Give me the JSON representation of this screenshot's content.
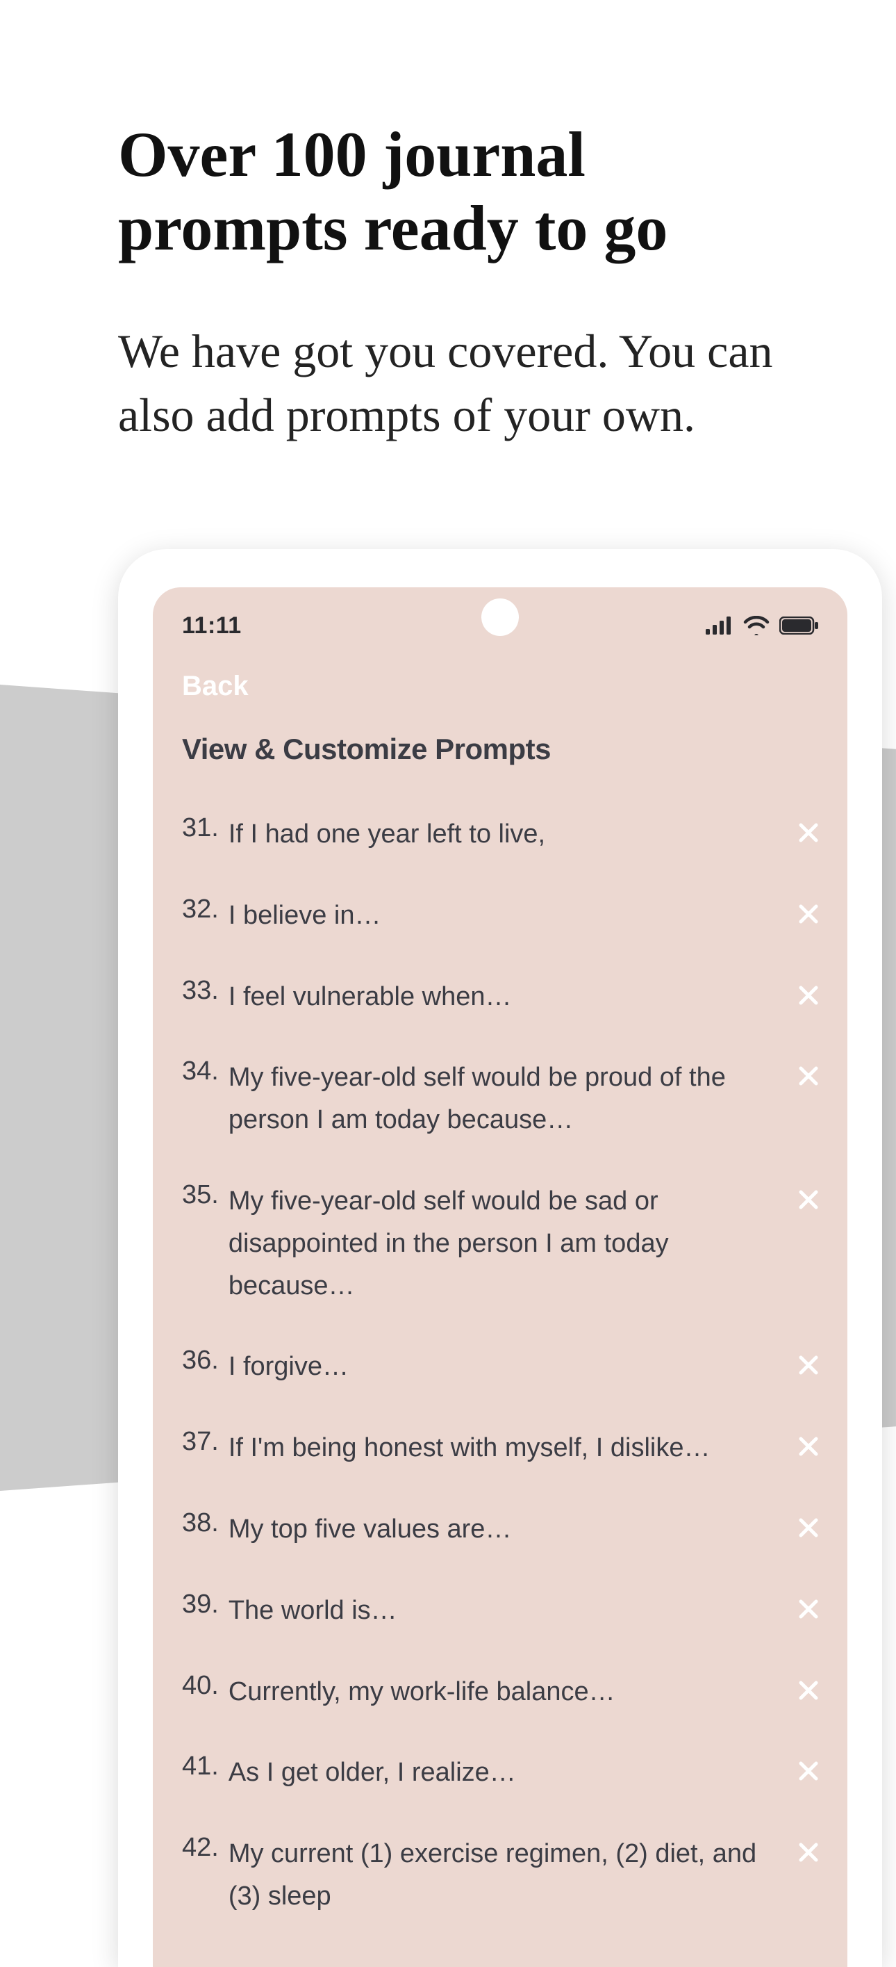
{
  "marketing": {
    "headline": "Over 100 journal prompts ready to go",
    "subhead": "We have got you covered. You can also add prompts of your own."
  },
  "statusBar": {
    "time": "11:11"
  },
  "nav": {
    "back": "Back"
  },
  "section": {
    "title": "View & Customize Prompts"
  },
  "prompts": [
    {
      "n": "31.",
      "text": "If I had one year left to live,"
    },
    {
      "n": "32.",
      "text": "I believe in…"
    },
    {
      "n": "33.",
      "text": "I feel vulnerable when…"
    },
    {
      "n": "34.",
      "text": "My five-year-old self would be proud of the person I am today because…"
    },
    {
      "n": "35.",
      "text": "My five-year-old self would be sad or disappointed in the person I am today because…"
    },
    {
      "n": "36.",
      "text": "I forgive…"
    },
    {
      "n": "37.",
      "text": "If I'm being honest with myself, I dislike…"
    },
    {
      "n": "38.",
      "text": "My top five values are…"
    },
    {
      "n": "39.",
      "text": "The world is…"
    },
    {
      "n": "40.",
      "text": "Currently, my work-life balance…"
    },
    {
      "n": "41.",
      "text": "As I get older, I realize…"
    },
    {
      "n": "42.",
      "text": "My current (1) exercise regimen, (2) diet, and (3) sleep"
    }
  ]
}
